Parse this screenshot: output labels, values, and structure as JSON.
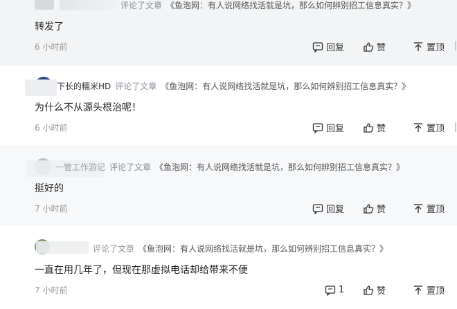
{
  "comments": [
    {
      "verb": "评论了文章",
      "name_partial": "",
      "article_title": "《鱼泡网：有人说网络找活就是坑，那么如何辨别招工信息真实？》",
      "body": "转发了",
      "time": "6 小时前",
      "reply_label": "回复",
      "like_label": "赞",
      "top_label": "置顶"
    },
    {
      "verb": "评论了文章",
      "name_partial": "下长的糯米HD",
      "article_title": "《鱼泡网：有人说网络找活就是坑，那么如何辨别招工信息真实？》",
      "body": "为什么不从源头根治呢！",
      "time": "6 小时前",
      "reply_label": "回复",
      "like_label": "赞",
      "top_label": "置顶"
    },
    {
      "verb": "评论了文章",
      "name_partial": "一管工作游记",
      "article_title": "《鱼泡网：有人说网络找活就是坑，那么如何辨别招工信息真实？》",
      "body": "挺好的",
      "time": "7 小时前",
      "reply_label": "回复",
      "like_label": "赞",
      "top_label": "置顶"
    },
    {
      "verb": "评论了文章",
      "name_partial": "",
      "article_title": "《鱼泡网：有人说网络找活就是坑，那么如何辨别招工信息真实？》",
      "body": "一直在用几年了，但现在那虚拟电话却给带来不便",
      "time": "7 小时前",
      "reply_count": "1",
      "like_label": "赞",
      "top_label": "置顶"
    }
  ],
  "icons": {
    "reply": "comment-bubble-icon",
    "like": "thumbs-up-icon",
    "top": "pin-top-icon"
  }
}
